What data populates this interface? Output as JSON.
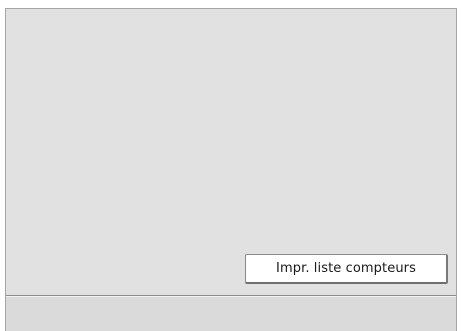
{
  "screen": {
    "buttons": {
      "print_counter_list_label": "Impr. liste compteurs"
    }
  },
  "colors": {
    "panel_background": "#e1e1e1",
    "button_background": "#ffffff",
    "border": "#8a8a8a"
  }
}
